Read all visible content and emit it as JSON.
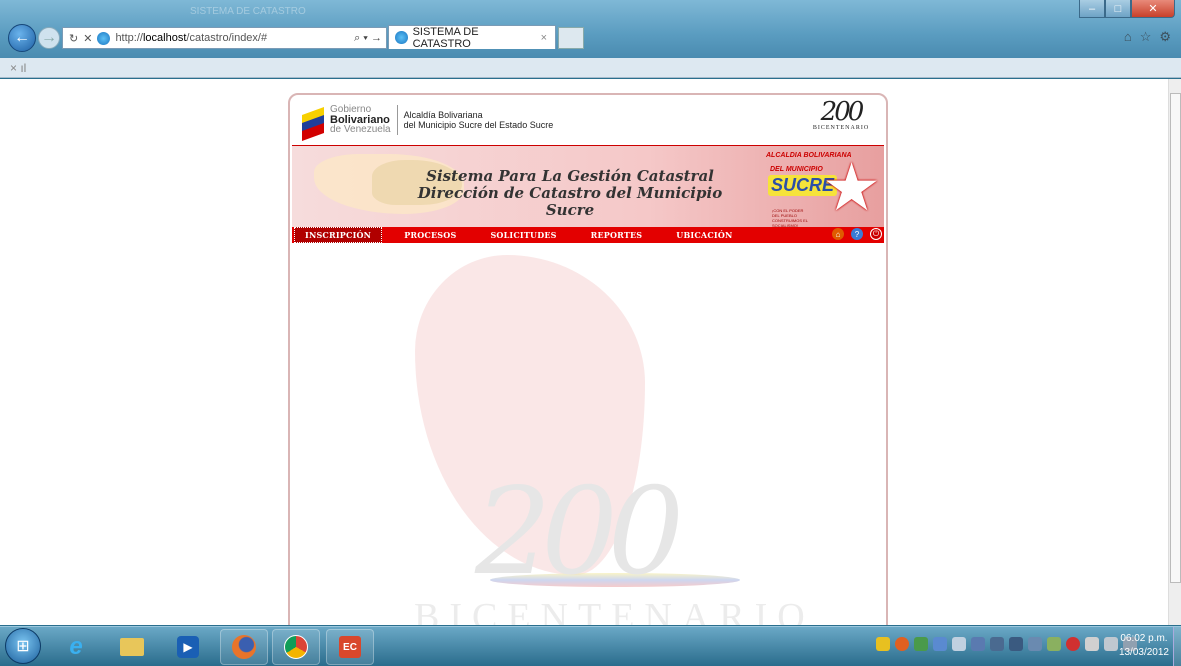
{
  "browser": {
    "faded_title": "SISTEMA DE CATASTRO",
    "address_prefix": "http://",
    "address_host": "localhost",
    "address_path": "/catastro/index/#",
    "tab_title": "SISTEMA DE CATASTRO",
    "tab_close": "×",
    "search_glyph": "⌕ ▾ →",
    "command_bar": "×  ıl",
    "tool_icons": [
      "home-icon",
      "star-icon",
      "gear-icon"
    ],
    "window_buttons": [
      "minimize",
      "maximize",
      "close"
    ]
  },
  "page": {
    "header": {
      "gob_line1": "Gobierno",
      "gob_line2": "Bolivariano",
      "gob_line3": "de Venezuela",
      "alcaldia_line1": "Alcaldía Bolivariana",
      "alcaldia_line2": "del Municipio Sucre del Estado Sucre",
      "logo_200": "200",
      "logo_bicentenario": "BICENTENARIO"
    },
    "banner": {
      "title_line1": "Sistema Para La Gestión Catastral",
      "title_line2": "Dirección de Catastro del Municipio Sucre",
      "sucre_line1": "ALCALDIA BOLIVARIANA",
      "sucre_line2": "DEL MUNICIPIO",
      "sucre_name": "SUCRE",
      "sucre_slogan": "¡CON EL PODER DEL PUEBLO CONSTRUIMOS EL SOCIALISMO!"
    },
    "menu": [
      {
        "label": "INSCRIPCIÓN",
        "active": true
      },
      {
        "label": "PROCESOS"
      },
      {
        "label": "SOLICITUDES"
      },
      {
        "label": "REPORTES"
      },
      {
        "label": "UBICACIÓN"
      }
    ],
    "menu_icons": [
      "home-icon",
      "help-icon",
      "power-icon"
    ],
    "watermark": {
      "num": "200",
      "word": "BICENTENARIO"
    }
  },
  "taskbar": {
    "apps": [
      "internet-explorer-icon",
      "folder-icon",
      "media-player-icon",
      "firefox-icon",
      "chrome-icon",
      "app-ec-icon"
    ],
    "time": "06:02 p.m.",
    "date": "13/03/2012"
  },
  "colors": {
    "menu_red": "#e30000",
    "accent": "#c00000"
  }
}
